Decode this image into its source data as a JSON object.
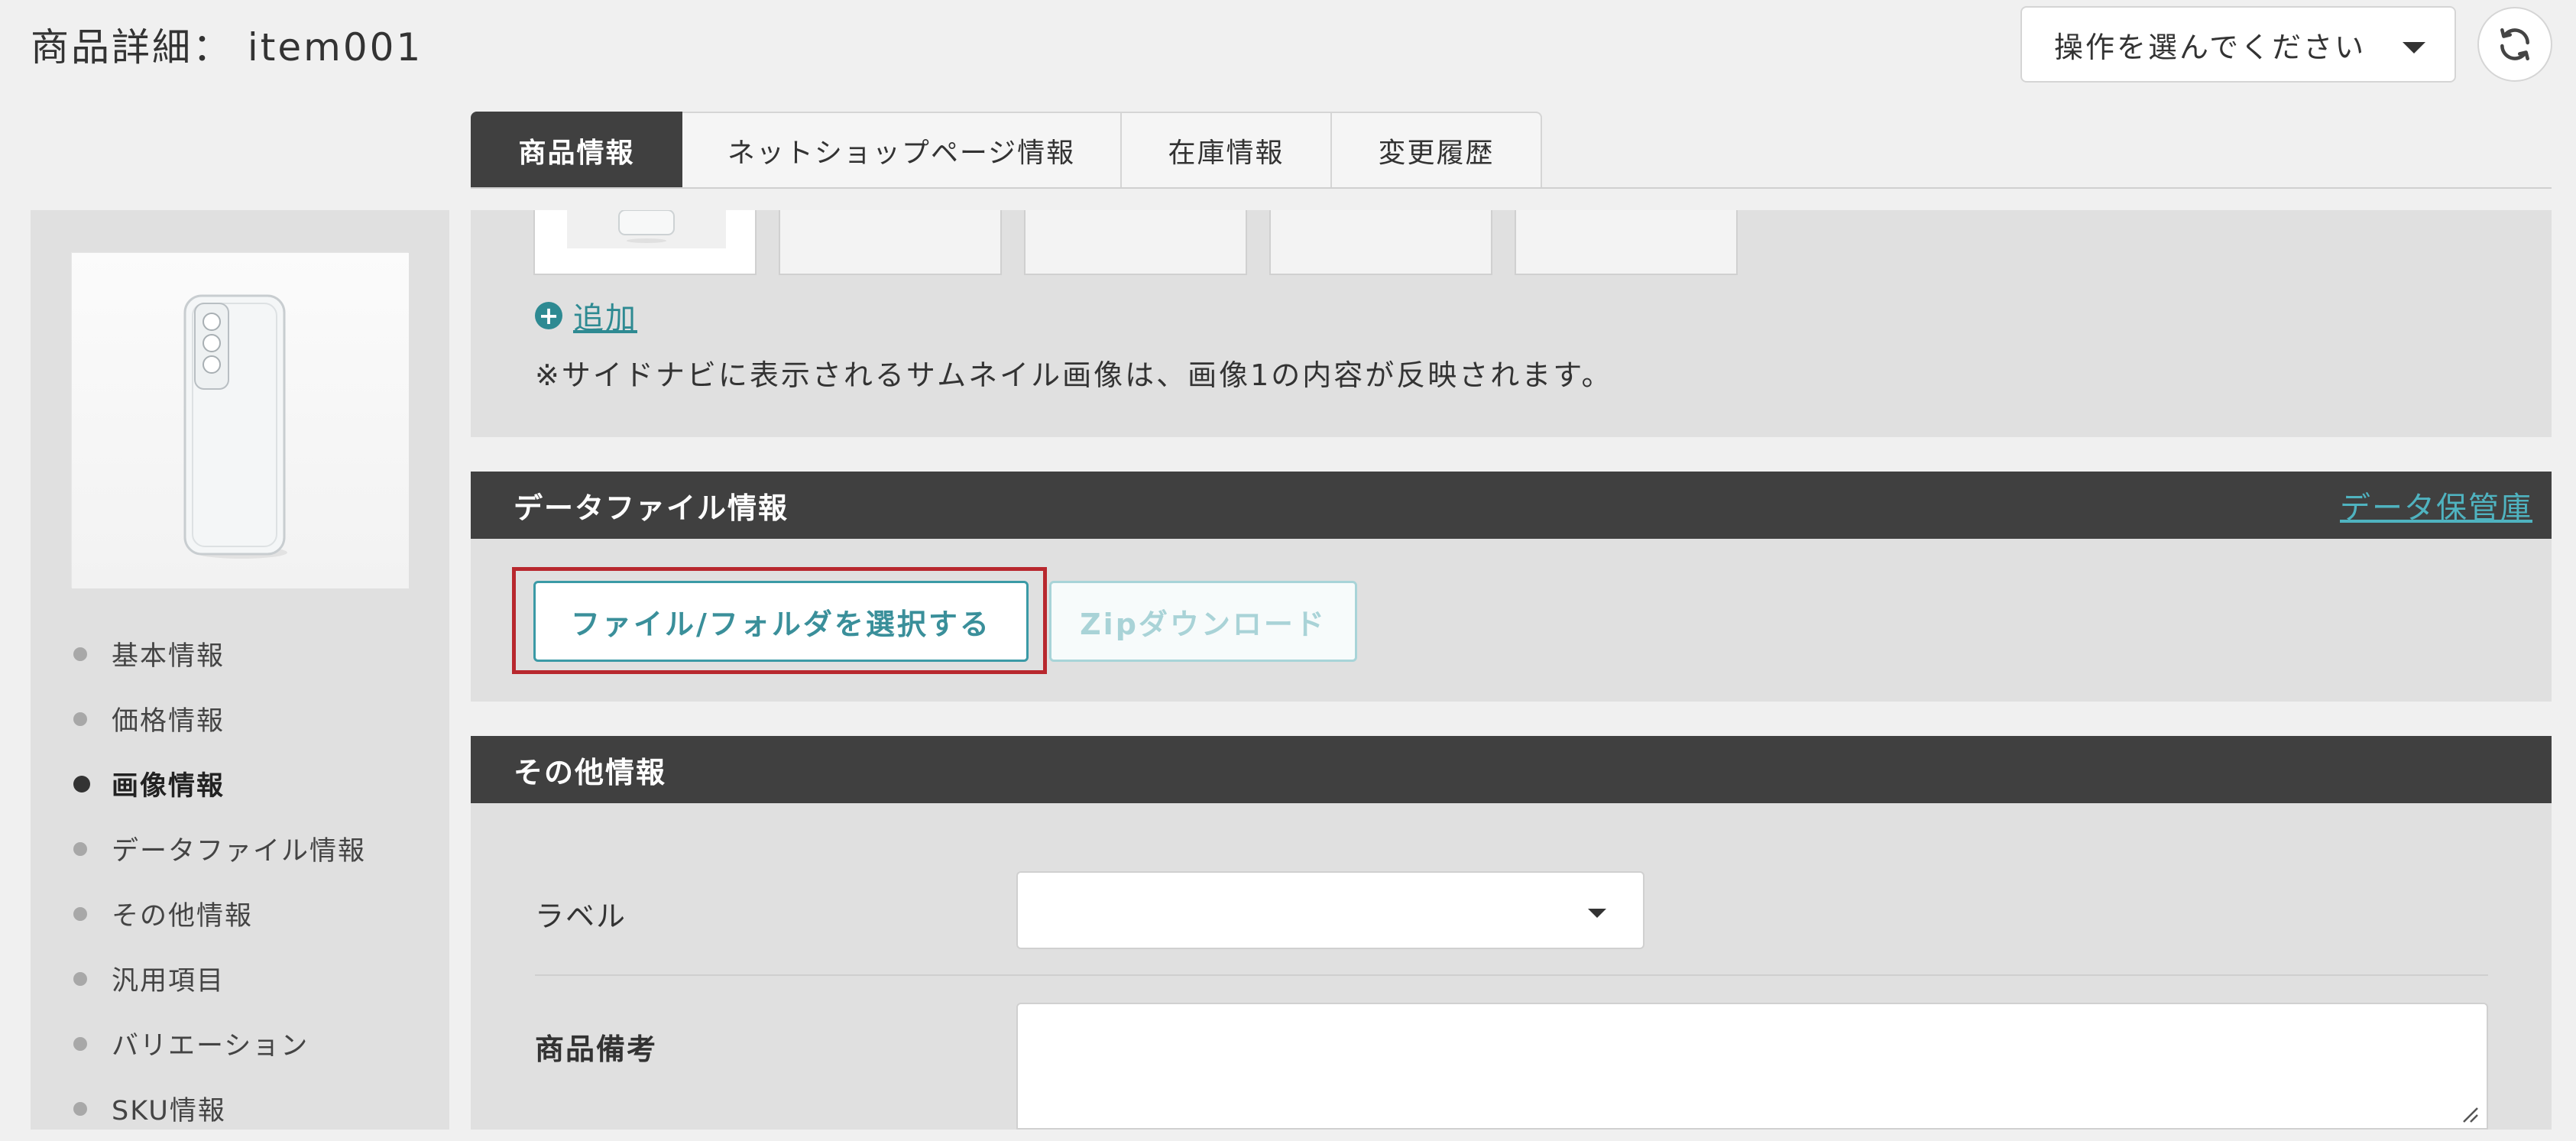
{
  "header": {
    "title": "商品詳細： item001",
    "operation_select": "操作を選んでください"
  },
  "tabs": [
    {
      "label": "商品情報",
      "active": true
    },
    {
      "label": "ネットショップページ情報",
      "active": false
    },
    {
      "label": "在庫情報",
      "active": false
    },
    {
      "label": "変更履歴",
      "active": false
    }
  ],
  "sidebar": {
    "thumbnail_icon": "phone-case-image",
    "nav": [
      {
        "label": "基本情報",
        "active": false
      },
      {
        "label": "価格情報",
        "active": false
      },
      {
        "label": "画像情報",
        "active": true
      },
      {
        "label": "データファイル情報",
        "active": false
      },
      {
        "label": "その他情報",
        "active": false
      },
      {
        "label": "汎用項目",
        "active": false
      },
      {
        "label": "バリエーション",
        "active": false
      },
      {
        "label": "SKU情報",
        "active": false
      }
    ]
  },
  "image_section": {
    "add_label": "追加",
    "note": "※サイドナビに表示されるサムネイル画像は、画像1の内容が反映されます。"
  },
  "data_file_section": {
    "title": "データファイル情報",
    "vault_link": "データ保管庫",
    "select_button": "ファイル/フォルダを選択する",
    "zip_button": "Zipダウンロード"
  },
  "other_section": {
    "title": "その他情報",
    "label_field": "ラベル",
    "label_value": "",
    "memo_field": "商品備考",
    "memo_value": ""
  },
  "colors": {
    "header_dark": "#404040",
    "accent_teal": "#3b9aa6",
    "highlight_red": "#b8282e"
  }
}
